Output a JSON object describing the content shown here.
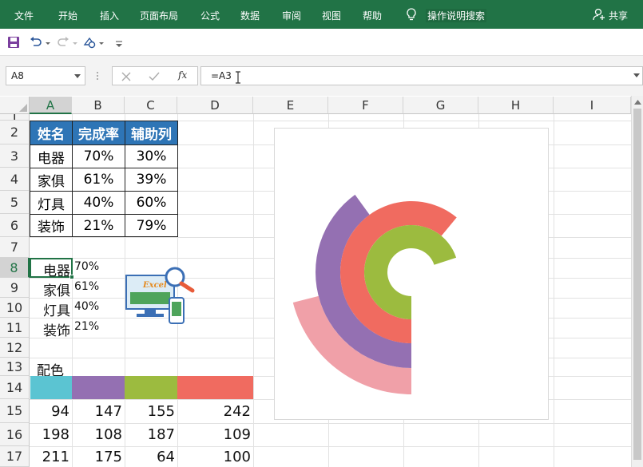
{
  "ribbon": {
    "tabs": [
      "文件",
      "开始",
      "插入",
      "页面布局",
      "公式",
      "数据",
      "审阅",
      "视图",
      "帮助"
    ],
    "tell_me": "操作说明搜索",
    "share": "共享"
  },
  "formula_bar": {
    "name_box": "A8",
    "formula": "=A3",
    "fx": "fx"
  },
  "columns": [
    "A",
    "B",
    "C",
    "D",
    "E",
    "F",
    "G",
    "H",
    "I"
  ],
  "rows": [
    "1",
    "2",
    "3",
    "4",
    "5",
    "6",
    "7",
    "8",
    "9",
    "10",
    "11",
    "12",
    "13",
    "14",
    "15",
    "16",
    "17"
  ],
  "table": {
    "headers": [
      "姓名",
      "完成率",
      "辅助列"
    ],
    "rows": [
      [
        "电器",
        "70%",
        "30%"
      ],
      [
        "家俱",
        "61%",
        "39%"
      ],
      [
        "灯具",
        "40%",
        "60%"
      ],
      [
        "装饰",
        "21%",
        "79%"
      ]
    ]
  },
  "labels": [
    [
      "电器",
      "70%"
    ],
    [
      "家俱",
      "61%"
    ],
    [
      "灯具",
      "40%"
    ],
    [
      "装饰",
      "21%"
    ]
  ],
  "logo_text": "Excel",
  "palette_label": "配色",
  "palette": [
    "#5bc4d2",
    "#9470b2",
    "#9cbb3f",
    "#f06b60"
  ],
  "rgb_rows": [
    [
      "94",
      "147",
      "155",
      "242"
    ],
    [
      "198",
      "108",
      "187",
      "109"
    ],
    [
      "211",
      "175",
      "64",
      "100"
    ]
  ],
  "chart_data": {
    "type": "pie",
    "variant": "concentric-rings",
    "series": [
      {
        "category": "电器",
        "value": 0.7,
        "color": "#9cbb3f"
      },
      {
        "category": "家俱",
        "value": 0.61,
        "color": "#f06b60"
      },
      {
        "category": "灯具",
        "value": 0.4,
        "color": "#9470b2"
      },
      {
        "category": "装饰",
        "value": 0.21,
        "color": "#f0a0a8"
      }
    ],
    "start_direction": "down",
    "sweep": "clockwise"
  }
}
